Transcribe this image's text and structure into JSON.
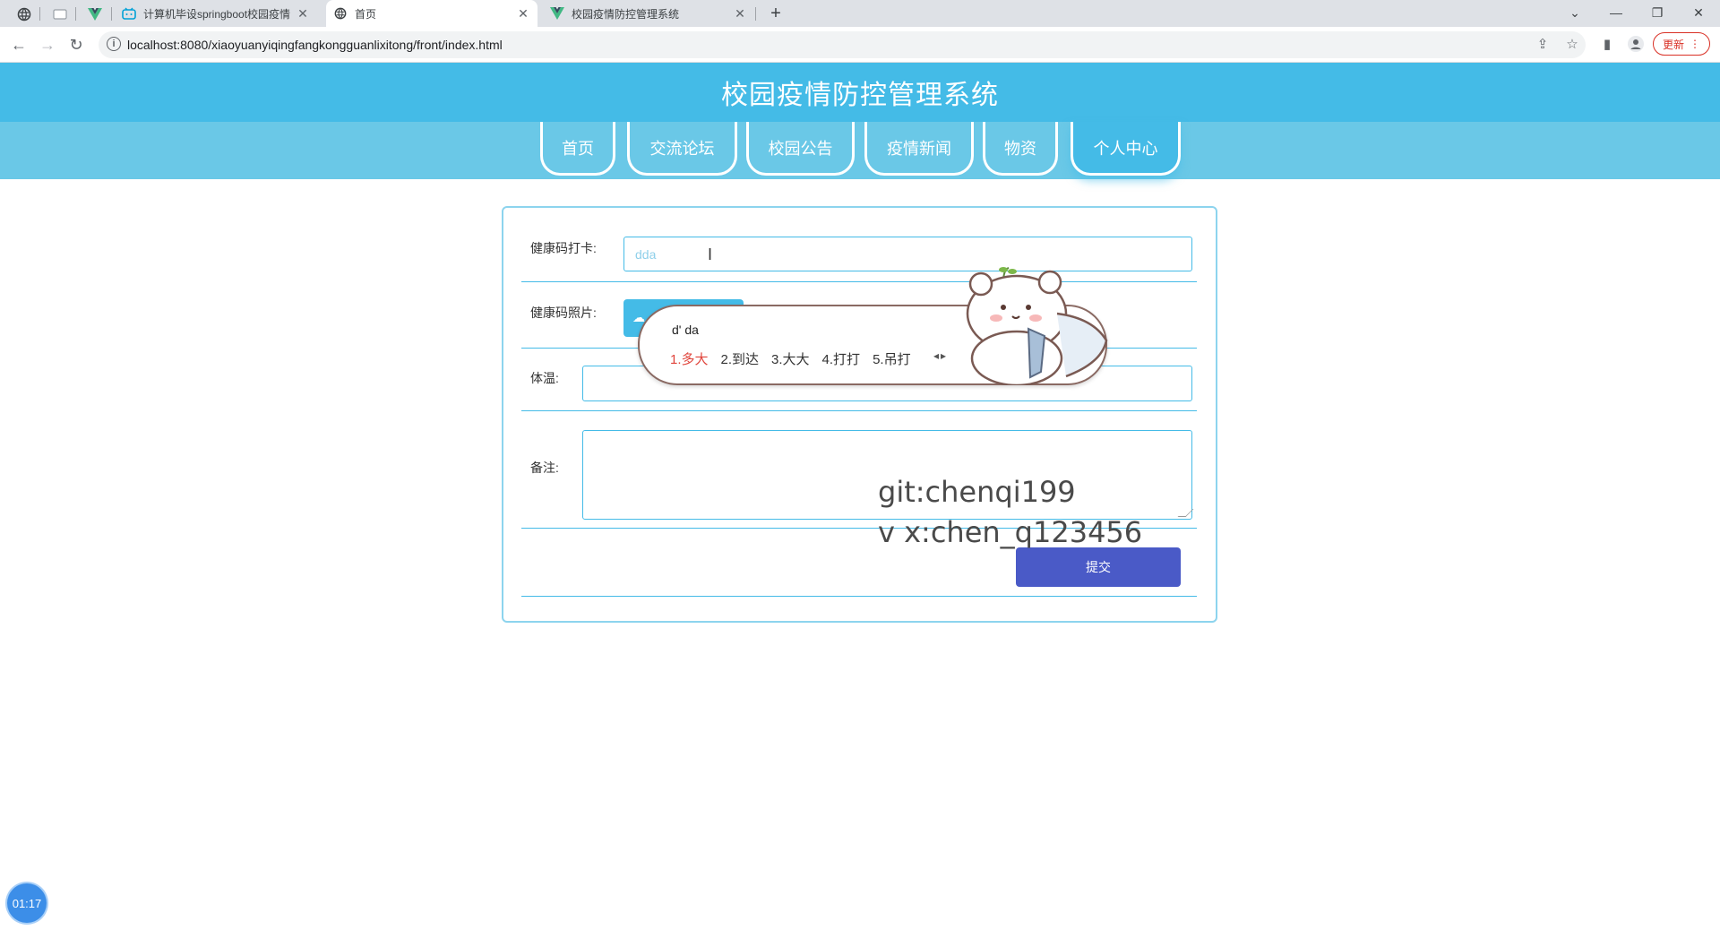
{
  "browser": {
    "tabs": [
      {
        "title": "计算机毕设springboot校园疫情",
        "active": false
      },
      {
        "title": "首页",
        "active": true
      },
      {
        "title": "校园疫情防控管理系统",
        "active": false
      }
    ],
    "url": "localhost:8080/xiaoyuanyiqingfangkongguanlixitong/front/index.html",
    "update_label": "更新"
  },
  "site": {
    "title": "校园疫情防控管理系统",
    "nav": [
      {
        "label": "首页",
        "active": false
      },
      {
        "label": "交流论坛",
        "active": false
      },
      {
        "label": "校园公告",
        "active": false
      },
      {
        "label": "疫情新闻",
        "active": false
      },
      {
        "label": "物资",
        "active": false
      },
      {
        "label": "个人中心",
        "active": true
      }
    ]
  },
  "form": {
    "health_code_checkin": {
      "label": "健康码打卡:",
      "value": "dda"
    },
    "health_code_photo": {
      "label": "健康码照片:"
    },
    "temperature": {
      "label": "体温:",
      "value": ""
    },
    "remark": {
      "label": "备注:",
      "value": ""
    },
    "submit_label": "提交"
  },
  "ime": {
    "composition": "d' da",
    "candidates": [
      "1.多大",
      "2.到达",
      "3.大大",
      "4.打打",
      "5.吊打"
    ],
    "selected_index": 0
  },
  "watermark": {
    "line1": "git:chenqi199",
    "line2": "v x:chen_q123456"
  },
  "timer": "01:17",
  "colors": {
    "header": "#44bbe7",
    "nav_band": "#6ac8e7",
    "submit": "#4a5ac7",
    "ime_selected": "#e0453c"
  }
}
